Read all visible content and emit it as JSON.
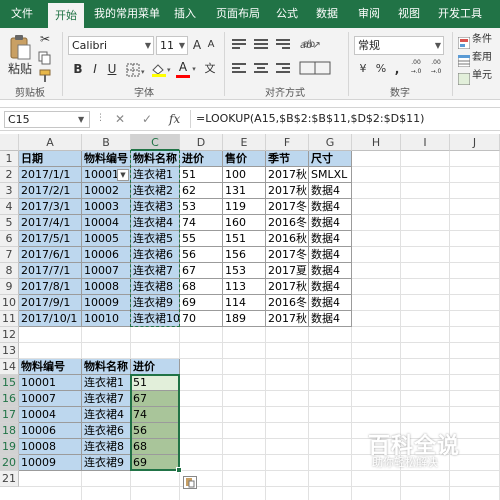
{
  "tabs": [
    "文件",
    "开始",
    "我的常用菜单",
    "插入",
    "页面布局",
    "公式",
    "数据",
    "审阅",
    "视图",
    "开发工具"
  ],
  "ribbon": {
    "paste_label": "粘贴",
    "clipboard_group": "剪贴板",
    "font_name": "Calibri",
    "font_size": "11",
    "font_group": "字体",
    "align_group": "对齐方式",
    "number_format": "常规",
    "number_group": "数字",
    "right_items": [
      "条件",
      "套用",
      "单元"
    ],
    "bold": "B",
    "italic": "I",
    "underline": "U",
    "wen": "文",
    "grow_font": "A",
    "shrink_font": "A",
    "font_color": "A",
    "wrap": "ab",
    "currency": "¥",
    "percent": "%",
    "comma": ",",
    "dec_inc": ".00 →.0",
    "dec_dec": ".00 →.0"
  },
  "formula_bar": {
    "namebox": "C15",
    "cancel": "✕",
    "enter": "✓",
    "fx": "fx",
    "formula": "=LOOKUP(A15,$B$2:$B$11,$D$2:$D$11)"
  },
  "columns": [
    "A",
    "B",
    "C",
    "D",
    "E",
    "F",
    "G",
    "H",
    "I",
    "J"
  ],
  "rows": [
    "1",
    "2",
    "3",
    "4",
    "5",
    "6",
    "7",
    "8",
    "9",
    "10",
    "11",
    "12",
    "13",
    "14",
    "15",
    "16",
    "17",
    "18",
    "19",
    "20",
    "21"
  ],
  "table1": {
    "header": [
      "日期",
      "物料编号",
      "物料名称",
      "进价",
      "售价",
      "季节",
      "尺寸"
    ],
    "rows": [
      [
        "2017/1/1",
        "10001",
        "连衣裙1",
        "51",
        "100",
        "2017秋",
        "SMLXL"
      ],
      [
        "2017/2/1",
        "10002",
        "连衣裙2",
        "62",
        "131",
        "2017秋",
        "数据4"
      ],
      [
        "2017/3/1",
        "10003",
        "连衣裙3",
        "53",
        "119",
        "2017冬",
        "数据4"
      ],
      [
        "2017/4/1",
        "10004",
        "连衣裙4",
        "74",
        "160",
        "2016冬",
        "数据4"
      ],
      [
        "2017/5/1",
        "10005",
        "连衣裙5",
        "55",
        "151",
        "2016秋",
        "数据4"
      ],
      [
        "2017/6/1",
        "10006",
        "连衣裙6",
        "56",
        "156",
        "2017冬",
        "数据4"
      ],
      [
        "2017/7/1",
        "10007",
        "连衣裙7",
        "67",
        "153",
        "2017夏",
        "数据4"
      ],
      [
        "2017/8/1",
        "10008",
        "连衣裙8",
        "68",
        "113",
        "2017秋",
        "数据4"
      ],
      [
        "2017/9/1",
        "10009",
        "连衣裙9",
        "69",
        "114",
        "2016冬",
        "数据4"
      ],
      [
        "2017/10/1",
        "10010",
        "连衣裙10",
        "70",
        "189",
        "2017秋",
        "数据4"
      ]
    ]
  },
  "table2": {
    "header": [
      "物料编号",
      "物料名称",
      "进价"
    ],
    "rows": [
      [
        "10001",
        "连衣裙1",
        "51"
      ],
      [
        "10007",
        "连衣裙7",
        "67"
      ],
      [
        "10004",
        "连衣裙4",
        "74"
      ],
      [
        "10006",
        "连衣裙6",
        "56"
      ],
      [
        "10008",
        "连衣裙8",
        "68"
      ],
      [
        "10009",
        "连衣裙9",
        "69"
      ]
    ]
  },
  "watermark": {
    "title": "百科全说",
    "subtitle": "助你轻松解决"
  }
}
